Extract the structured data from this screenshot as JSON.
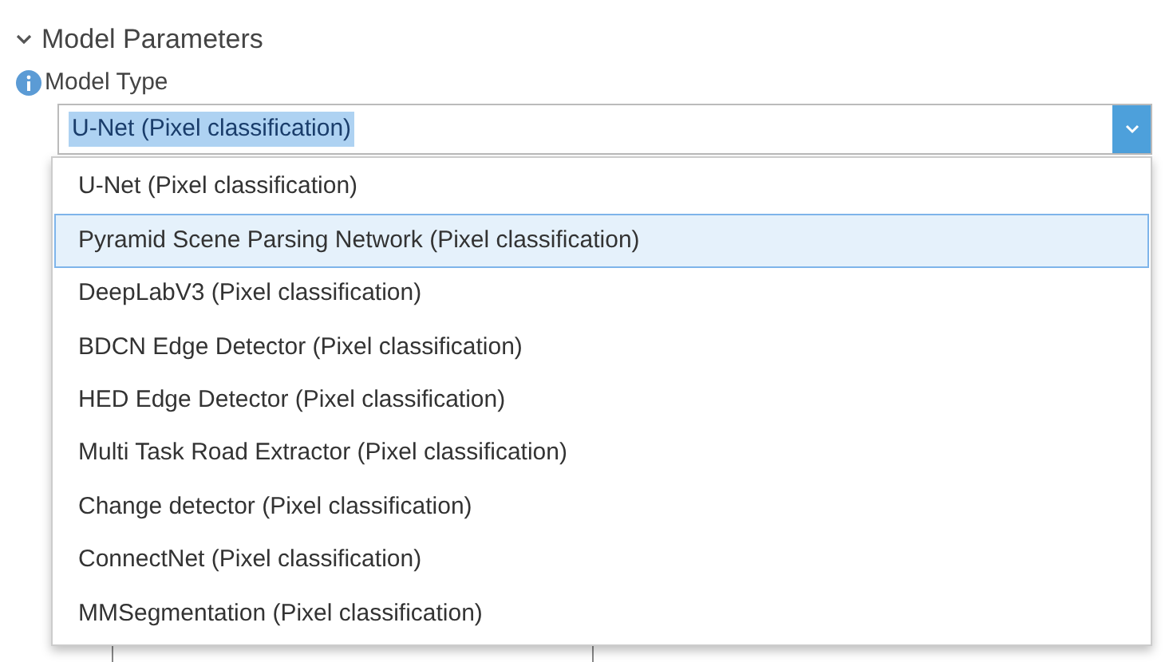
{
  "section": {
    "title": "Model Parameters",
    "expanded": true
  },
  "field": {
    "label": "Model Type",
    "value": "U-Net (Pixel classification)",
    "text_selected": true,
    "open": true
  },
  "options": [
    {
      "label": "U-Net (Pixel classification)",
      "selected": false
    },
    {
      "label": "Pyramid Scene Parsing Network (Pixel classification)",
      "selected": true
    },
    {
      "label": "DeepLabV3 (Pixel classification)",
      "selected": false
    },
    {
      "label": "BDCN Edge Detector (Pixel classification)",
      "selected": false
    },
    {
      "label": "HED Edge Detector (Pixel classification)",
      "selected": false
    },
    {
      "label": "Multi Task Road Extractor (Pixel classification)",
      "selected": false
    },
    {
      "label": "Change detector (Pixel classification)",
      "selected": false
    },
    {
      "label": "ConnectNet (Pixel classification)",
      "selected": false
    },
    {
      "label": "MMSegmentation (Pixel classification)",
      "selected": false
    }
  ]
}
